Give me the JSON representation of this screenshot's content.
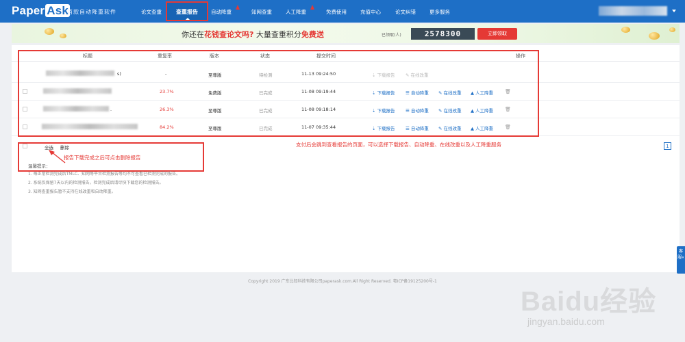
{
  "nav": {
    "logo_main": "Paper",
    "logo_accent": "Ask",
    "slogan": "首款自动降重软件",
    "items": [
      "论文查重",
      "查重报告",
      "自动降重",
      "知网查重",
      "人工降重",
      "免费使用",
      "充值中心",
      "论文纠错",
      "更多服务"
    ],
    "active_index": 1
  },
  "banner": {
    "title_prefix": "你还在",
    "title_red1": "花钱查论文吗?",
    "title_mid": " 大量查重积分",
    "title_red2": "免费送",
    "claimed_label": "已领取(人)",
    "claimed_count": "2578300",
    "claim_button": "立即领取"
  },
  "table": {
    "headers": [
      "标题",
      "重复率",
      "版本",
      "状态",
      "提交时间",
      "操作"
    ],
    "rows": [
      {
        "rate": "-",
        "version": "至尊版",
        "status": "待检测",
        "time": "11-13 09:24:50",
        "title_suffix": "s)"
      },
      {
        "rate": "23.7%",
        "version": "免费版",
        "status": "已完成",
        "time": "11-08 09:19:44",
        "title_suffix": ""
      },
      {
        "rate": "26.3%",
        "version": "至尊版",
        "status": "已完成",
        "time": "11-08 09:18:14",
        "title_suffix": "."
      },
      {
        "rate": "84.2%",
        "version": "至尊版",
        "status": "已完成",
        "time": "11-07 09:35:44",
        "title_suffix": ""
      }
    ],
    "actions": {
      "download": "下载报告",
      "online_edit": "在线改重",
      "auto_reduce": "自动降重",
      "manual_reduce": "人工降重"
    }
  },
  "footer_actions": {
    "select_all": "全选",
    "delete": "删除"
  },
  "annotations": {
    "note": "支付后会跳到查看报告的页面，可以选择下载报告、自动降重、在线改重以及人工降重服务",
    "delete_hint": "报告下载完成之后可点击删除报告"
  },
  "pagination": {
    "current": "1"
  },
  "tips": {
    "title": "温馨提示：",
    "items": [
      "1. 每正常检测完成后TMLC、知网等平台检测报告等均不可查看已检测完成的报告。",
      "2. 系统仅保留7天以内的检测报告，检测完成后请尽快下载您的检测报告。",
      "3. 知网查重报告暂不支持在线改重和自动降重。"
    ]
  },
  "side_tab": "客服«",
  "copyright": "Copyright 2019 广东比知科技有限公司paperask.com.All Right Reserved. 粤ICP备19125200号-1",
  "watermark": {
    "main": "Baidu经验",
    "sub": "jingyan.baidu.com"
  },
  "colors": {
    "nav_blue": "#1e6fc6",
    "accent_red": "#e53935",
    "counter_bg": "#3a4a56"
  }
}
